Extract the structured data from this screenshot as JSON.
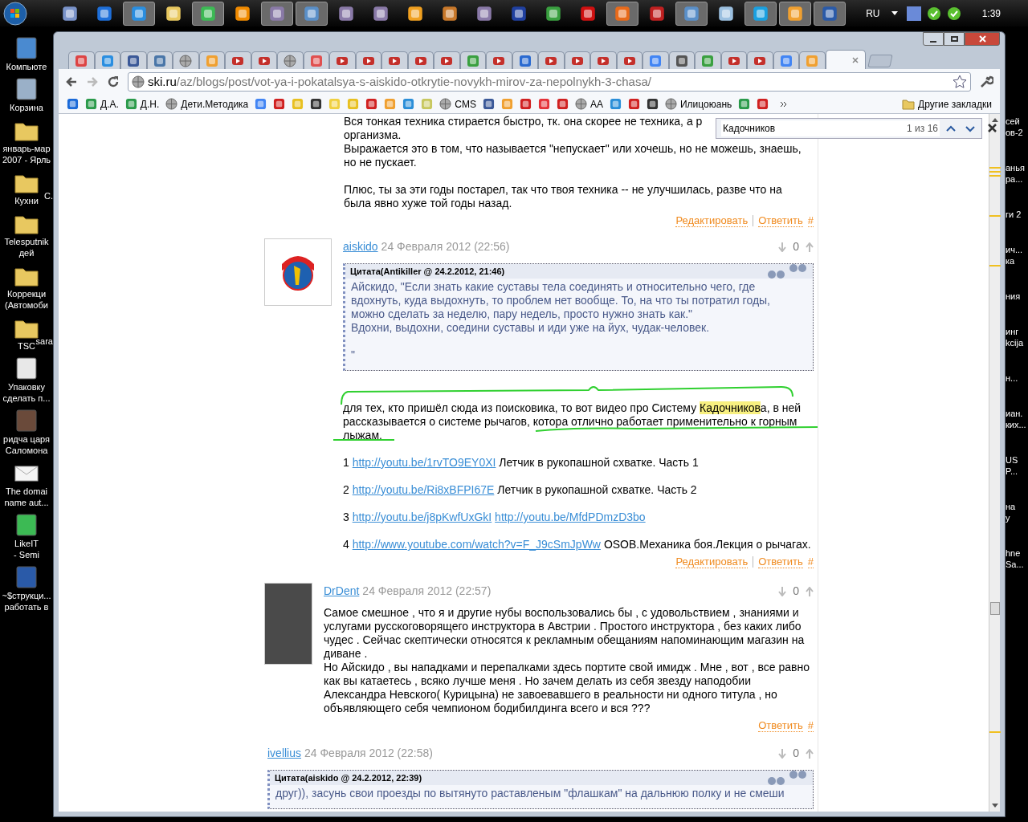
{
  "taskbar": {
    "items": [
      {
        "kind": "calculator",
        "open": false
      },
      {
        "kind": "teamviewer",
        "open": false
      },
      {
        "kind": "ie",
        "open": true
      },
      {
        "kind": "folder",
        "open": false
      },
      {
        "kind": "chrome",
        "open": true
      },
      {
        "kind": "vlc",
        "open": false
      },
      {
        "kind": "app",
        "open": true
      },
      {
        "kind": "monitor",
        "open": true
      },
      {
        "kind": "app",
        "open": false
      },
      {
        "kind": "app",
        "open": false
      },
      {
        "kind": "media",
        "open": false
      },
      {
        "kind": "cookie",
        "open": false
      },
      {
        "kind": "app",
        "open": false
      },
      {
        "kind": "floppy",
        "open": false
      },
      {
        "kind": "picasa",
        "open": false
      },
      {
        "kind": "opera",
        "open": false
      },
      {
        "kind": "firefox",
        "open": true
      },
      {
        "kind": "filezilla",
        "open": false
      },
      {
        "kind": "monitor",
        "open": true
      },
      {
        "kind": "notepad",
        "open": false
      },
      {
        "kind": "skype",
        "open": true
      },
      {
        "kind": "orange",
        "open": true
      },
      {
        "kind": "word",
        "open": true
      }
    ],
    "language": "RU",
    "clock": "1:39"
  },
  "desktop_left": [
    {
      "kind": "computer",
      "lines": [
        "Компьюте"
      ]
    },
    {
      "kind": "trash",
      "lines": [
        "Корзина"
      ]
    },
    {
      "kind": "folder",
      "lines": [
        "январь-мар",
        "2007 - Ярль"
      ]
    },
    {
      "kind": "folder",
      "lines": [
        "Кухни"
      ],
      "fragment": "С."
    },
    {
      "kind": "folder",
      "lines": [
        "Telesputnik",
        "дей"
      ]
    },
    {
      "kind": "folder",
      "lines": [
        "Коррекци",
        "(Автомоби"
      ]
    },
    {
      "kind": "folder",
      "lines": [
        "TSC"
      ],
      "fragment": "sara"
    },
    {
      "kind": "document",
      "lines": [
        "Упаковку",
        "сделать п..."
      ]
    },
    {
      "kind": "image",
      "lines": [
        "ридча царя",
        "Саломона"
      ]
    },
    {
      "kind": "envelope",
      "lines": [
        "The domai",
        "name aut..."
      ]
    },
    {
      "kind": "chrome",
      "lines": [
        "LikeIT",
        "- Semi"
      ]
    },
    {
      "kind": "word",
      "lines": [
        "~$струкци...",
        "работать в"
      ]
    }
  ],
  "desktop_right": [
    [
      "сей",
      "ов-2"
    ],
    [
      "анья",
      "ра..."
    ],
    [
      "ги 2"
    ],
    [
      "ич...",
      "ка"
    ],
    [
      "ния"
    ],
    [
      "инг",
      "kcija"
    ],
    [
      "н..."
    ],
    [
      "иан.",
      "ких..."
    ],
    [
      "US",
      "P..."
    ],
    [
      "на",
      "у"
    ],
    [
      "hne",
      "Sa..."
    ]
  ],
  "tabs": [
    {
      "kind": "gmail",
      "selected": false
    },
    {
      "kind": "it",
      "selected": false
    },
    {
      "kind": "facebook",
      "selected": false
    },
    {
      "kind": "vk",
      "selected": false
    },
    {
      "kind": "globe",
      "selected": false
    },
    {
      "kind": "orange",
      "selected": false
    },
    {
      "kind": "youtube",
      "selected": false
    },
    {
      "kind": "youtube",
      "selected": false
    },
    {
      "kind": "globe",
      "selected": false
    },
    {
      "kind": "alert",
      "selected": false
    },
    {
      "kind": "youtube",
      "selected": false
    },
    {
      "kind": "youtube",
      "selected": false
    },
    {
      "kind": "youtube",
      "selected": false
    },
    {
      "kind": "youtube",
      "selected": false
    },
    {
      "kind": "youtube",
      "selected": false
    },
    {
      "kind": "play",
      "selected": false
    },
    {
      "kind": "youtube",
      "selected": false
    },
    {
      "kind": "spiral",
      "selected": false
    },
    {
      "kind": "youtube",
      "selected": false
    },
    {
      "kind": "youtube",
      "selected": false
    },
    {
      "kind": "youtube",
      "selected": false
    },
    {
      "kind": "youtube",
      "selected": false
    },
    {
      "kind": "google",
      "selected": false
    },
    {
      "kind": "pause",
      "selected": false
    },
    {
      "kind": "play",
      "selected": false
    },
    {
      "kind": "youtube",
      "selected": false
    },
    {
      "kind": "youtube",
      "selected": false
    },
    {
      "kind": "google",
      "selected": false
    },
    {
      "kind": "orange",
      "selected": false
    },
    {
      "kind": "blank",
      "selected": true
    }
  ],
  "address": {
    "host": "ski.ru",
    "path": "/az/blogs/post/vot-ya-i-pokatalsya-s-aiskido-otkrytie-novykh-mirov-za-nepolnykh-3-chasa/"
  },
  "bookmarks": [
    {
      "kind": "ball"
    },
    {
      "kind": "sheet",
      "label": "Д.А."
    },
    {
      "kind": "sheet",
      "label": "Д.Н."
    },
    {
      "kind": "globe",
      "label": "Дети.Методика"
    },
    {
      "kind": "google"
    },
    {
      "kind": "red"
    },
    {
      "kind": "yellow"
    },
    {
      "kind": "dark"
    },
    {
      "kind": "bulb"
    },
    {
      "kind": "yellow"
    },
    {
      "kind": "red"
    },
    {
      "kind": "orange"
    },
    {
      "kind": "blue"
    },
    {
      "kind": "lemon"
    },
    {
      "kind": "globe",
      "label": "CMS"
    },
    {
      "kind": "facebook"
    },
    {
      "kind": "orange"
    },
    {
      "kind": "red"
    },
    {
      "kind": "ebay"
    },
    {
      "kind": "red"
    },
    {
      "kind": "globe",
      "label": "AA"
    },
    {
      "kind": "blue"
    },
    {
      "kind": "red"
    },
    {
      "kind": "dark"
    },
    {
      "kind": "globe",
      "label": "Илицоюань"
    },
    {
      "kind": "sheet"
    },
    {
      "kind": "red"
    }
  ],
  "other_bookmarks": "Другие закладки",
  "find_bar": {
    "query": "Кадочников",
    "count": "1 из 16"
  },
  "posts": [
    {
      "kind": "continuation",
      "lines": [
        [
          "Вся тонкая техника стирается быстро, тк. она скорее не техника, а р",
          "организма.",
          "Выражается это в том, что называется \"непускает\" или хочешь, но не можешь, знаешь,",
          "но не пускает."
        ],
        [
          "Плюс, ты за эти годы постарел, так что твоя техника -- не улучшилась, разве что на",
          "была явно хуже той годы назад."
        ]
      ],
      "actions": [
        "Редактировать",
        "Ответить",
        "#"
      ]
    },
    {
      "kind": "logo",
      "author": "aiskido",
      "date": "24 Февраля 2012 (22:56)",
      "score": "0",
      "quote": {
        "header": "Цитата(Antikiller @ 24.2.2012, 21:46)",
        "paragraphs": [
          "Айскидо, \"Если знать какие суставы тела соединять и относительно чего, где вдохнуть, куда выдохнуть, то проблем нет вообще. То, на что ты потратил годы, можно сделать за неделю, пару недель, просто нужно знать как.\"",
          "Вдохни, выдохни, соедини суставы и иди уже на йух, чудак-человек.",
          "\""
        ]
      },
      "body": {
        "before": "для тех, кто пришёл сюда из поисковика, то вот видео про Систему ",
        "highlight": "Кадочников",
        "after": "а, в ней рассказывается о системе рычагов, котора отлично работает применительно к горным лыжам."
      },
      "links": [
        {
          "number": "1",
          "urls": [
            "http://youtu.be/1rvTO9EY0XI"
          ],
          "text": "Летчик в рукопашной схватке. Часть 1"
        },
        {
          "number": "2",
          "urls": [
            "http://youtu.be/Ri8xBFPI67E"
          ],
          "text": "Летчик в рукопашной схватке. Часть 2"
        },
        {
          "number": "3",
          "urls": [
            "http://youtu.be/j8pKwfUxGkI",
            "http://youtu.be/MfdPDmzD3bo"
          ]
        },
        {
          "number": "4",
          "urls": [
            "http://www.youtube.com/watch?v=F_J9cSmJpWw"
          ],
          "text": "OSOB.Механика боя.Лекция о рычагах."
        }
      ],
      "actions": [
        "Редактировать",
        "Ответить",
        "#"
      ]
    },
    {
      "kind": "photo",
      "author": "DrDent",
      "date": "24 Февраля 2012 (22:57)",
      "score": "0",
      "paragraphs": [
        "Самое смешное , что я и другие нубы воспользовались бы , с удовольствием , знаниями и услугами русскоговорящего инструктора в Австрии . Простого инструктора , без каких либо чудес . Сейчас скептически относятся к рекламным обещаниям напоминающим магазин на диване .",
        "Но Айскидо , вы нападками и перепалками здесь портите свой имидж . Мне , вот , все равно как вы катаетесь , всяко лучше меня . Но зачем делать из себя звезду наподобии Александра Невского( Курицына) не завоевавшего в реальности ни одного титула , но объявляющего себя чемпионом бодибилдинга всего и вся ???"
      ],
      "actions": [
        "Ответить",
        "#"
      ]
    },
    {
      "kind": "plain",
      "author": "ivellius",
      "date": "24 Февраля 2012 (22:58)",
      "score": "0",
      "quote": {
        "header": "Цитата(aiskido @ 24.2.2012, 22:39)",
        "paragraphs": [
          "друг)), засунь свои проезды по вытянуто раставленым \"флашкам\" на дальнюю полку и не смеши"
        ]
      }
    }
  ]
}
